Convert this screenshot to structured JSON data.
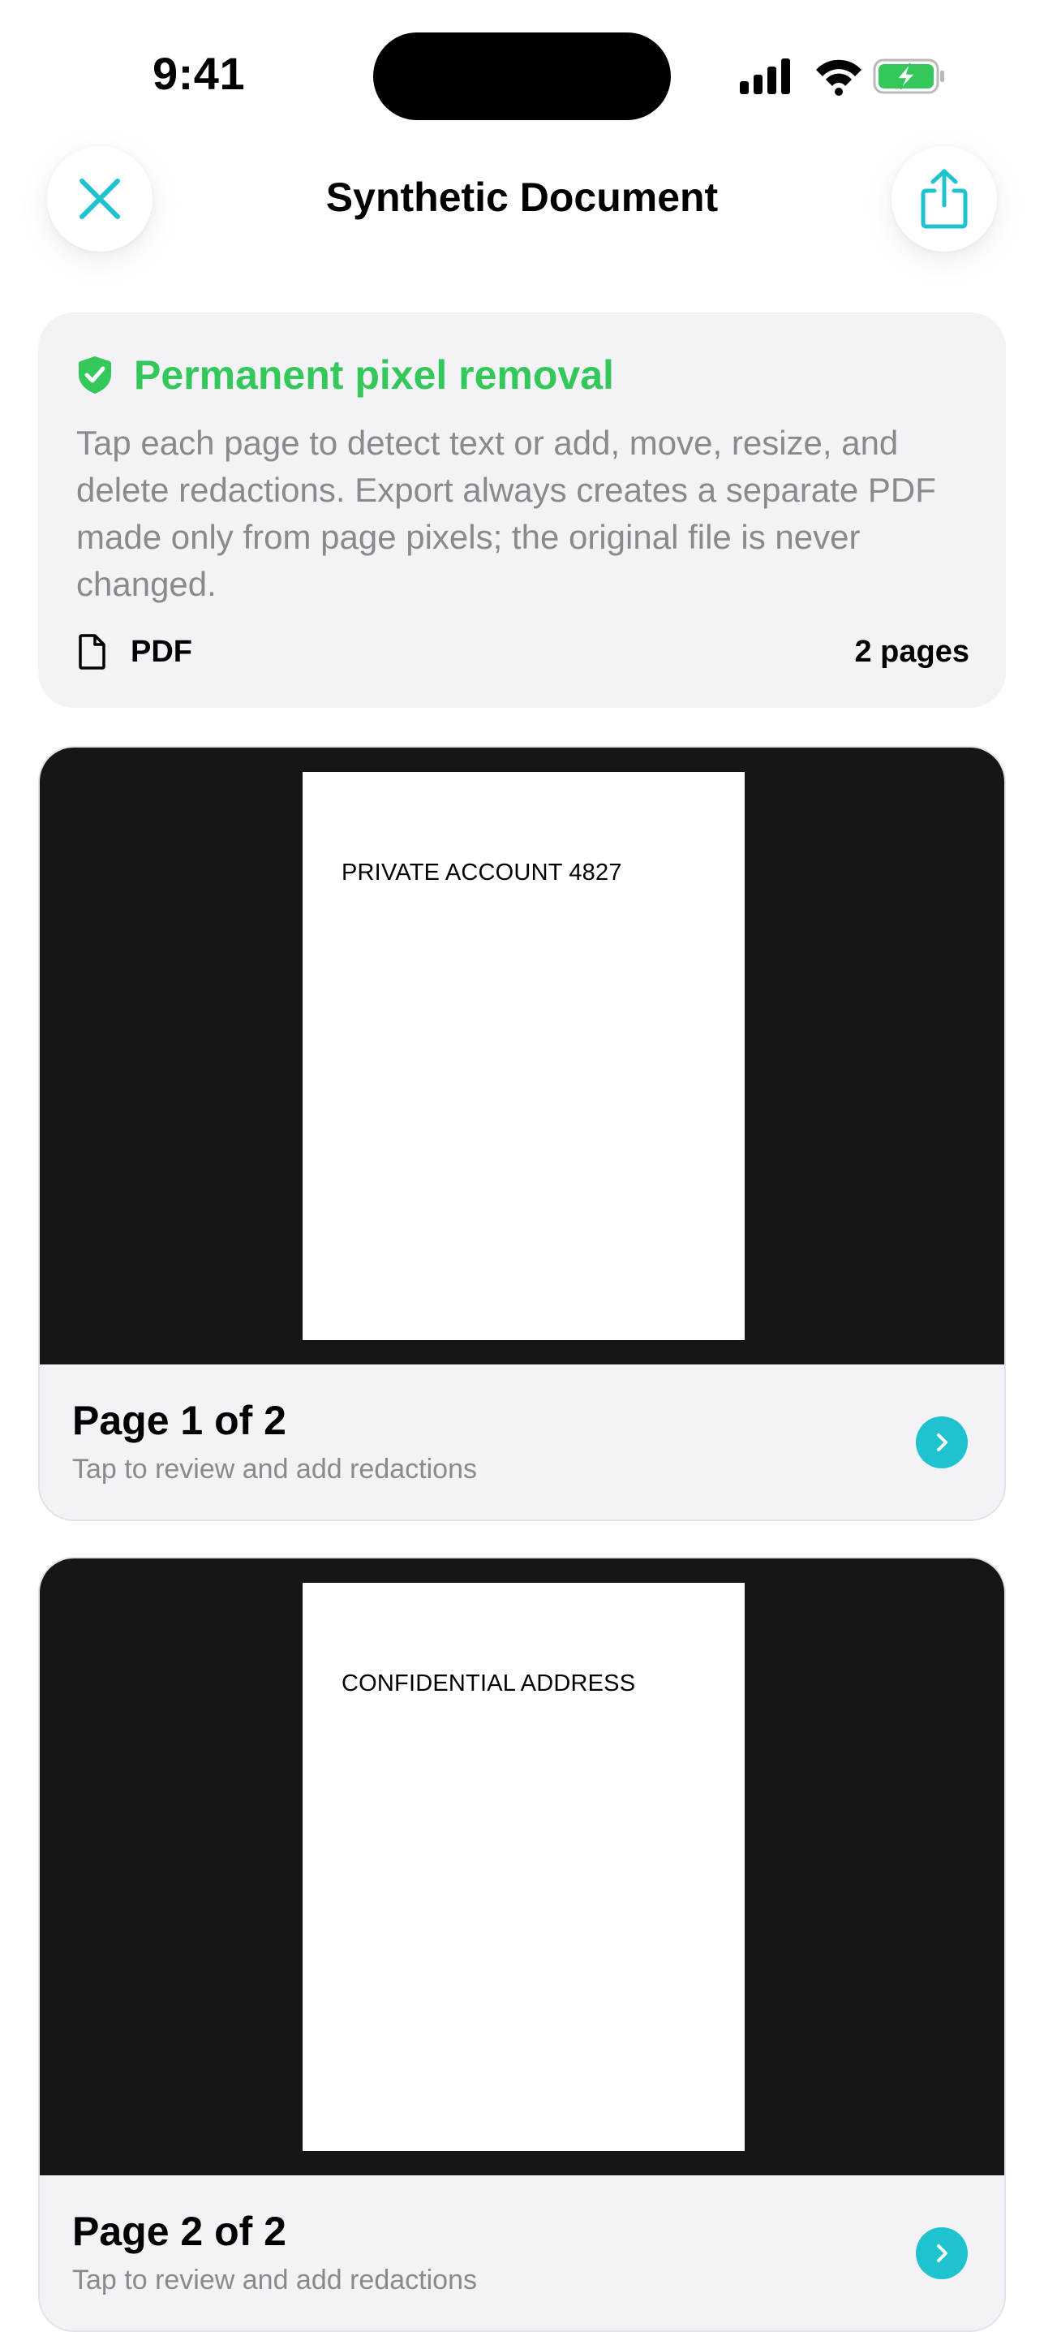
{
  "status_bar": {
    "time": "9:41",
    "icons": [
      "cellular-signal-icon",
      "wifi-icon",
      "battery-charging-icon"
    ]
  },
  "nav": {
    "title": "Synthetic Document",
    "close_icon": "close-icon",
    "share_icon": "share-icon"
  },
  "info": {
    "title": "Permanent pixel removal",
    "icon": "shield-check-icon",
    "body": "Tap each page to detect text or add, move, resize, and delete redactions. Export always creates a separate PDF made only from page pixels; the original file is never changed.",
    "file_type": "PDF",
    "file_icon": "document-icon",
    "page_count": "2 pages"
  },
  "pages": [
    {
      "sheet_text": "PRIVATE ACCOUNT 4827",
      "title": "Page 1 of 2",
      "subtitle": "Tap to review and add redactions"
    },
    {
      "sheet_text": "CONFIDENTIAL ADDRESS",
      "title": "Page 2 of 2",
      "subtitle": "Tap to review and add redactions"
    }
  ],
  "colors": {
    "accent": "#1fc2cf",
    "success": "#34c759",
    "card_bg": "#f2f2f7",
    "preview_bg": "#161616",
    "secondary_text": "#8a8a8e"
  }
}
